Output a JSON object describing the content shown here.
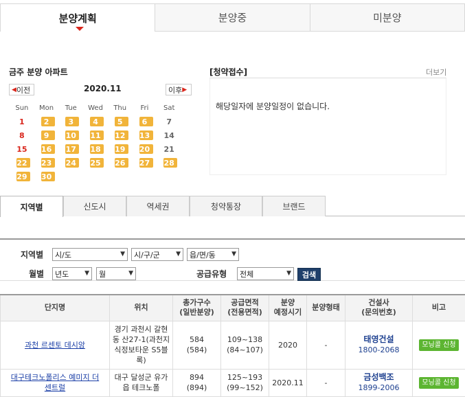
{
  "top_tabs": [
    "분양계획",
    "분양중",
    "미분양"
  ],
  "weekly_title": "금주 분양 아파트",
  "subscription_title": "[청약접수]",
  "more_label": "더보기",
  "calendar": {
    "prev_label": "이전",
    "next_label": "이후",
    "month": "2020.11",
    "weekdays": [
      "Sun",
      "Mon",
      "Tue",
      "Wed",
      "Thu",
      "Fri",
      "Sat"
    ],
    "weeks": [
      [
        "1",
        "2",
        "3",
        "4",
        "5",
        "6",
        "7"
      ],
      [
        "8",
        "9",
        "10",
        "11",
        "12",
        "13",
        "14"
      ],
      [
        "15",
        "16",
        "17",
        "18",
        "19",
        "20",
        "21"
      ],
      [
        "22",
        "23",
        "24",
        "25",
        "26",
        "27",
        "28"
      ],
      [
        "29",
        "30",
        "",
        "",
        "",
        "",
        ""
      ]
    ],
    "highlighted_days": [
      "2",
      "3",
      "4",
      "5",
      "6",
      "9",
      "10",
      "11",
      "12",
      "13",
      "16",
      "17",
      "18",
      "19",
      "20",
      "22",
      "23",
      "24",
      "25",
      "26",
      "27",
      "28",
      "29",
      "30"
    ]
  },
  "subscription_empty": "해당일자에 분양일정이 없습니다.",
  "sub_tabs": [
    "지역별",
    "신도시",
    "역세권",
    "청약통장",
    "브랜드"
  ],
  "filter": {
    "region_label": "지역별",
    "month_label": "월별",
    "supply_label": "공급유형",
    "sido": "시/도",
    "sigungu": "시/구/군",
    "dong": "읍/면/동",
    "year": "년도",
    "month": "월",
    "supply": "전체",
    "search_label": "검색"
  },
  "table": {
    "headers": [
      "단지명",
      "위치",
      "총가구수\n(일반분양)",
      "공급면적\n(전용면적)",
      "분양\n예정시기",
      "분양형태",
      "건설사\n(문의번호)",
      "비고"
    ],
    "rows": [
      {
        "name": "과천 르센토 데시앙",
        "name_line2": "",
        "location": "경기 과천시 갈현동 산27-1(과천지식정보타운 S5블록)",
        "households": "584",
        "households_general": "(584)",
        "area": "109~138",
        "area_exclusive": "(84~107)",
        "period": "2020",
        "type": "-",
        "builder": "태영건설",
        "phone": "1800-2068",
        "note": "모닝콜 신청"
      },
      {
        "name": "대구테크노폴리스 예미지 더",
        "name_line2": "센트럴",
        "location": "대구 달성군 유가읍 테크노폴",
        "households": "894",
        "households_general": "(894)",
        "area": "125~193",
        "area_exclusive": "(99~152)",
        "period": "2020.11",
        "type": "-",
        "builder": "금성백조",
        "phone": "1899-2006",
        "note": "모닝콜 신청"
      }
    ]
  }
}
